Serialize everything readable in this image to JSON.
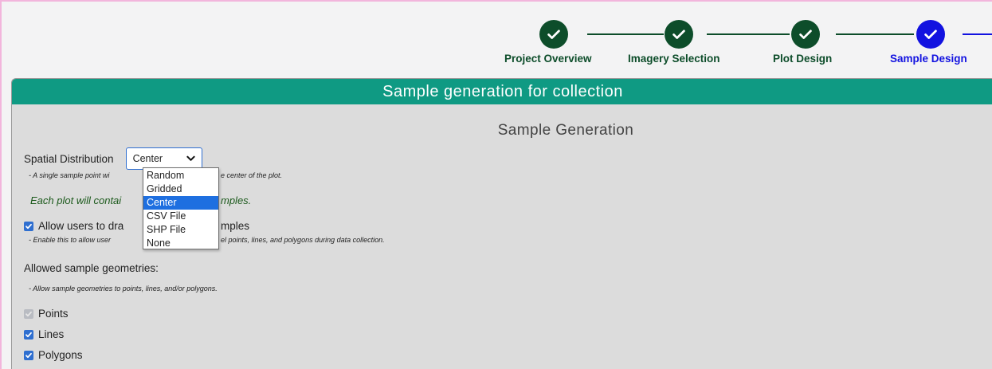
{
  "stepper": {
    "steps": [
      {
        "label": "Project Overview",
        "state": "complete"
      },
      {
        "label": "Imagery Selection",
        "state": "complete"
      },
      {
        "label": "Plot Design",
        "state": "complete"
      },
      {
        "label": "Sample Design",
        "state": "active"
      }
    ],
    "colors": {
      "complete": "#0d4d2a",
      "active": "#1212e0"
    }
  },
  "card": {
    "header": "Sample generation for collection",
    "section_title": "Sample Generation",
    "spatial_distribution": {
      "label": "Spatial Distribution",
      "selected": "Center",
      "options": [
        "Random",
        "Gridded",
        "Center",
        "CSV File",
        "SHP File",
        "None"
      ]
    },
    "distribution_hint": "- A single sample point wi",
    "distribution_hint_tail": "e center of the plot.",
    "samples_note": "Each plot will contai",
    "samples_note_tail": "mples.",
    "allow_draw": {
      "label": "Allow users to dra",
      "label_tail": "mples",
      "checked": true,
      "hint": "- Enable this to allow user",
      "hint_tail": "el points, lines, and polygons during data collection."
    },
    "geometries": {
      "label": "Allowed sample geometries:",
      "hint": "- Allow sample geometries to points, lines, and/or polygons.",
      "items": [
        {
          "label": "Points",
          "checked": true,
          "disabled": true
        },
        {
          "label": "Lines",
          "checked": true,
          "disabled": false
        },
        {
          "label": "Polygons",
          "checked": true,
          "disabled": false
        }
      ]
    }
  },
  "theme": {
    "header_bg": "#0f9a83",
    "card_bg": "#dcdcdc",
    "accent": "#2f6fd0"
  }
}
